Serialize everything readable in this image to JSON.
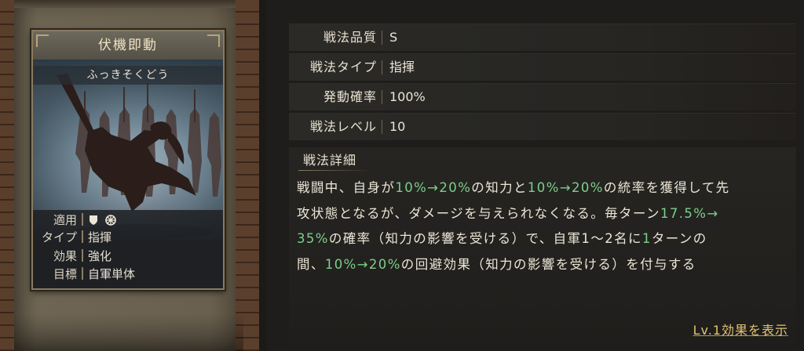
{
  "card": {
    "name": "伏機即動",
    "reading": "ふっきそくどう",
    "info": [
      {
        "key": "適用",
        "value": "",
        "icons": [
          "shield-icon",
          "wheel-icon"
        ]
      },
      {
        "key": "タイプ",
        "value": "指揮"
      },
      {
        "key": "効果",
        "value": "強化"
      },
      {
        "key": "目標",
        "value": "自軍単体"
      }
    ]
  },
  "stats": [
    {
      "label": "戦法品質",
      "value": "S"
    },
    {
      "label": "戦法タイプ",
      "value": "指揮"
    },
    {
      "label": "発動確率",
      "value": "100%"
    },
    {
      "label": "戦法レベル",
      "value": "10"
    }
  ],
  "detail": {
    "title": "戦法詳細",
    "lines": [
      [
        {
          "t": "戦闘中、自身が"
        },
        {
          "t": "10%→20%",
          "hl": true
        },
        {
          "t": "の知力と"
        },
        {
          "t": "10%→20%",
          "hl": true
        },
        {
          "t": "の統率を獲得して先"
        }
      ],
      [
        {
          "t": "攻状態となるが、ダメージを与えられなくなる。毎ターン"
        },
        {
          "t": "17.5%→",
          "hl": true
        }
      ],
      [
        {
          "t": "35%",
          "hl": true
        },
        {
          "t": "の確率（知力の影響を受ける）で、自軍1〜2名に"
        },
        {
          "t": "1",
          "hl": true
        },
        {
          "t": "ターンの"
        }
      ],
      [
        {
          "t": "間、"
        },
        {
          "t": "10%→20%",
          "hl": true
        },
        {
          "t": "の回避効果（知力の影響を受ける）を付与する"
        }
      ]
    ],
    "highlight_color": "#7dcf8a"
  },
  "link": {
    "label": "Lv.1効果を表示"
  }
}
